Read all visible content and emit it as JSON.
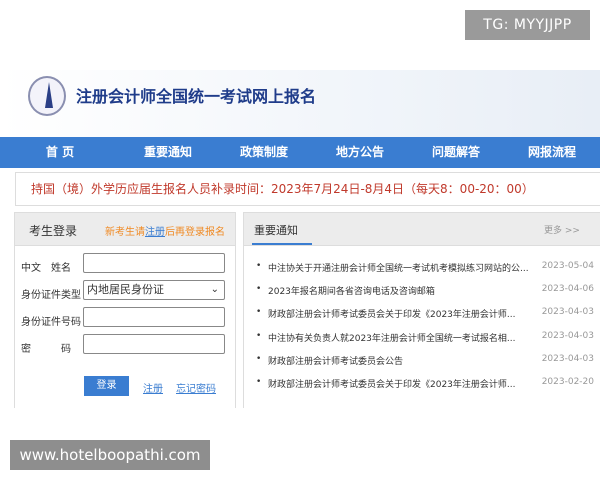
{
  "watermarks": {
    "top": "TG: MYYJJPP",
    "bottom": "www.hotelboopathi.com"
  },
  "header": {
    "title": "注册会计师全国统一考试网上报名"
  },
  "nav": [
    "首 页",
    "重要通知",
    "政策制度",
    "地方公告",
    "问题解答",
    "网报流程"
  ],
  "notice": "持国（境）外学历应届生报名人员补录时间：2023年7月24日-8月4日（每天8：00-20：00）",
  "login": {
    "title": "考生登录",
    "tip_before": "新考生请",
    "tip_link": "注册",
    "tip_after": "后再登录报名",
    "fields": [
      {
        "label": "中文　姓名",
        "value": ""
      },
      {
        "label": "身份证件类型",
        "value": "内地居民身份证"
      },
      {
        "label": "身份证件号码",
        "value": ""
      },
      {
        "label": "密　　　码",
        "value": ""
      }
    ],
    "login_button": "登录",
    "register_link": "注册",
    "forgot_link": "忘记密码"
  },
  "news": {
    "tab": "重要通知",
    "more": "更多 >>",
    "items": [
      {
        "title": "中注协关于开通注册会计师全国统一考试机考模拟练习网站的公...",
        "date": "2023-05-04"
      },
      {
        "title": "2023年报名期间各省咨询电话及咨询邮箱",
        "date": "2023-04-06"
      },
      {
        "title": "财政部注册会计师考试委员会关于印发《2023年注册会计师...",
        "date": "2023-04-03"
      },
      {
        "title": "中注协有关负责人就2023年注册会计师全国统一考试报名相...",
        "date": "2023-04-03"
      },
      {
        "title": "财政部注册会计师考试委员会公告",
        "date": "2023-04-03"
      },
      {
        "title": "财政部注册会计师考试委员会关于印发《2023年注册会计师...",
        "date": "2023-02-20"
      }
    ]
  }
}
